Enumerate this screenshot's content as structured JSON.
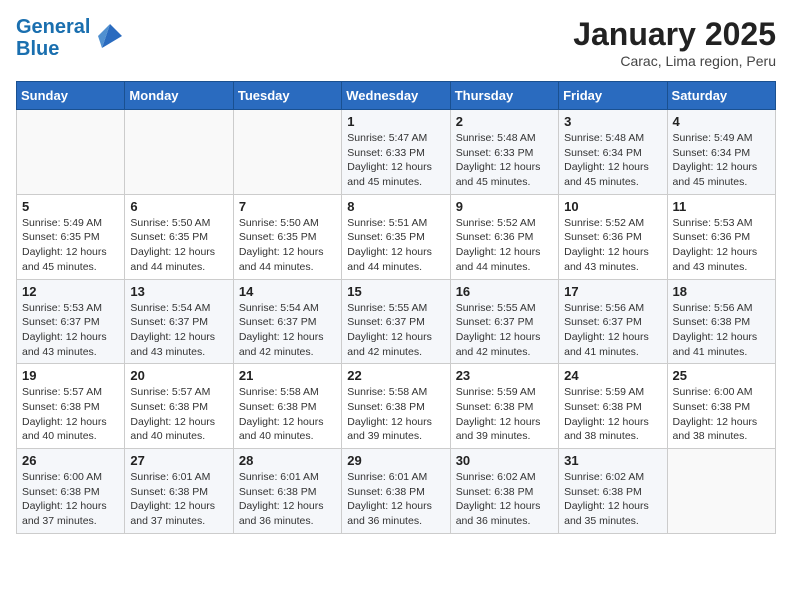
{
  "header": {
    "logo_line1": "General",
    "logo_line2": "Blue",
    "month_title": "January 2025",
    "location": "Carac, Lima region, Peru"
  },
  "weekdays": [
    "Sunday",
    "Monday",
    "Tuesday",
    "Wednesday",
    "Thursday",
    "Friday",
    "Saturday"
  ],
  "weeks": [
    [
      {
        "day": "",
        "info": ""
      },
      {
        "day": "",
        "info": ""
      },
      {
        "day": "",
        "info": ""
      },
      {
        "day": "1",
        "info": "Sunrise: 5:47 AM\nSunset: 6:33 PM\nDaylight: 12 hours\nand 45 minutes."
      },
      {
        "day": "2",
        "info": "Sunrise: 5:48 AM\nSunset: 6:33 PM\nDaylight: 12 hours\nand 45 minutes."
      },
      {
        "day": "3",
        "info": "Sunrise: 5:48 AM\nSunset: 6:34 PM\nDaylight: 12 hours\nand 45 minutes."
      },
      {
        "day": "4",
        "info": "Sunrise: 5:49 AM\nSunset: 6:34 PM\nDaylight: 12 hours\nand 45 minutes."
      }
    ],
    [
      {
        "day": "5",
        "info": "Sunrise: 5:49 AM\nSunset: 6:35 PM\nDaylight: 12 hours\nand 45 minutes."
      },
      {
        "day": "6",
        "info": "Sunrise: 5:50 AM\nSunset: 6:35 PM\nDaylight: 12 hours\nand 44 minutes."
      },
      {
        "day": "7",
        "info": "Sunrise: 5:50 AM\nSunset: 6:35 PM\nDaylight: 12 hours\nand 44 minutes."
      },
      {
        "day": "8",
        "info": "Sunrise: 5:51 AM\nSunset: 6:35 PM\nDaylight: 12 hours\nand 44 minutes."
      },
      {
        "day": "9",
        "info": "Sunrise: 5:52 AM\nSunset: 6:36 PM\nDaylight: 12 hours\nand 44 minutes."
      },
      {
        "day": "10",
        "info": "Sunrise: 5:52 AM\nSunset: 6:36 PM\nDaylight: 12 hours\nand 43 minutes."
      },
      {
        "day": "11",
        "info": "Sunrise: 5:53 AM\nSunset: 6:36 PM\nDaylight: 12 hours\nand 43 minutes."
      }
    ],
    [
      {
        "day": "12",
        "info": "Sunrise: 5:53 AM\nSunset: 6:37 PM\nDaylight: 12 hours\nand 43 minutes."
      },
      {
        "day": "13",
        "info": "Sunrise: 5:54 AM\nSunset: 6:37 PM\nDaylight: 12 hours\nand 43 minutes."
      },
      {
        "day": "14",
        "info": "Sunrise: 5:54 AM\nSunset: 6:37 PM\nDaylight: 12 hours\nand 42 minutes."
      },
      {
        "day": "15",
        "info": "Sunrise: 5:55 AM\nSunset: 6:37 PM\nDaylight: 12 hours\nand 42 minutes."
      },
      {
        "day": "16",
        "info": "Sunrise: 5:55 AM\nSunset: 6:37 PM\nDaylight: 12 hours\nand 42 minutes."
      },
      {
        "day": "17",
        "info": "Sunrise: 5:56 AM\nSunset: 6:37 PM\nDaylight: 12 hours\nand 41 minutes."
      },
      {
        "day": "18",
        "info": "Sunrise: 5:56 AM\nSunset: 6:38 PM\nDaylight: 12 hours\nand 41 minutes."
      }
    ],
    [
      {
        "day": "19",
        "info": "Sunrise: 5:57 AM\nSunset: 6:38 PM\nDaylight: 12 hours\nand 40 minutes."
      },
      {
        "day": "20",
        "info": "Sunrise: 5:57 AM\nSunset: 6:38 PM\nDaylight: 12 hours\nand 40 minutes."
      },
      {
        "day": "21",
        "info": "Sunrise: 5:58 AM\nSunset: 6:38 PM\nDaylight: 12 hours\nand 40 minutes."
      },
      {
        "day": "22",
        "info": "Sunrise: 5:58 AM\nSunset: 6:38 PM\nDaylight: 12 hours\nand 39 minutes."
      },
      {
        "day": "23",
        "info": "Sunrise: 5:59 AM\nSunset: 6:38 PM\nDaylight: 12 hours\nand 39 minutes."
      },
      {
        "day": "24",
        "info": "Sunrise: 5:59 AM\nSunset: 6:38 PM\nDaylight: 12 hours\nand 38 minutes."
      },
      {
        "day": "25",
        "info": "Sunrise: 6:00 AM\nSunset: 6:38 PM\nDaylight: 12 hours\nand 38 minutes."
      }
    ],
    [
      {
        "day": "26",
        "info": "Sunrise: 6:00 AM\nSunset: 6:38 PM\nDaylight: 12 hours\nand 37 minutes."
      },
      {
        "day": "27",
        "info": "Sunrise: 6:01 AM\nSunset: 6:38 PM\nDaylight: 12 hours\nand 37 minutes."
      },
      {
        "day": "28",
        "info": "Sunrise: 6:01 AM\nSunset: 6:38 PM\nDaylight: 12 hours\nand 36 minutes."
      },
      {
        "day": "29",
        "info": "Sunrise: 6:01 AM\nSunset: 6:38 PM\nDaylight: 12 hours\nand 36 minutes."
      },
      {
        "day": "30",
        "info": "Sunrise: 6:02 AM\nSunset: 6:38 PM\nDaylight: 12 hours\nand 36 minutes."
      },
      {
        "day": "31",
        "info": "Sunrise: 6:02 AM\nSunset: 6:38 PM\nDaylight: 12 hours\nand 35 minutes."
      },
      {
        "day": "",
        "info": ""
      }
    ]
  ]
}
